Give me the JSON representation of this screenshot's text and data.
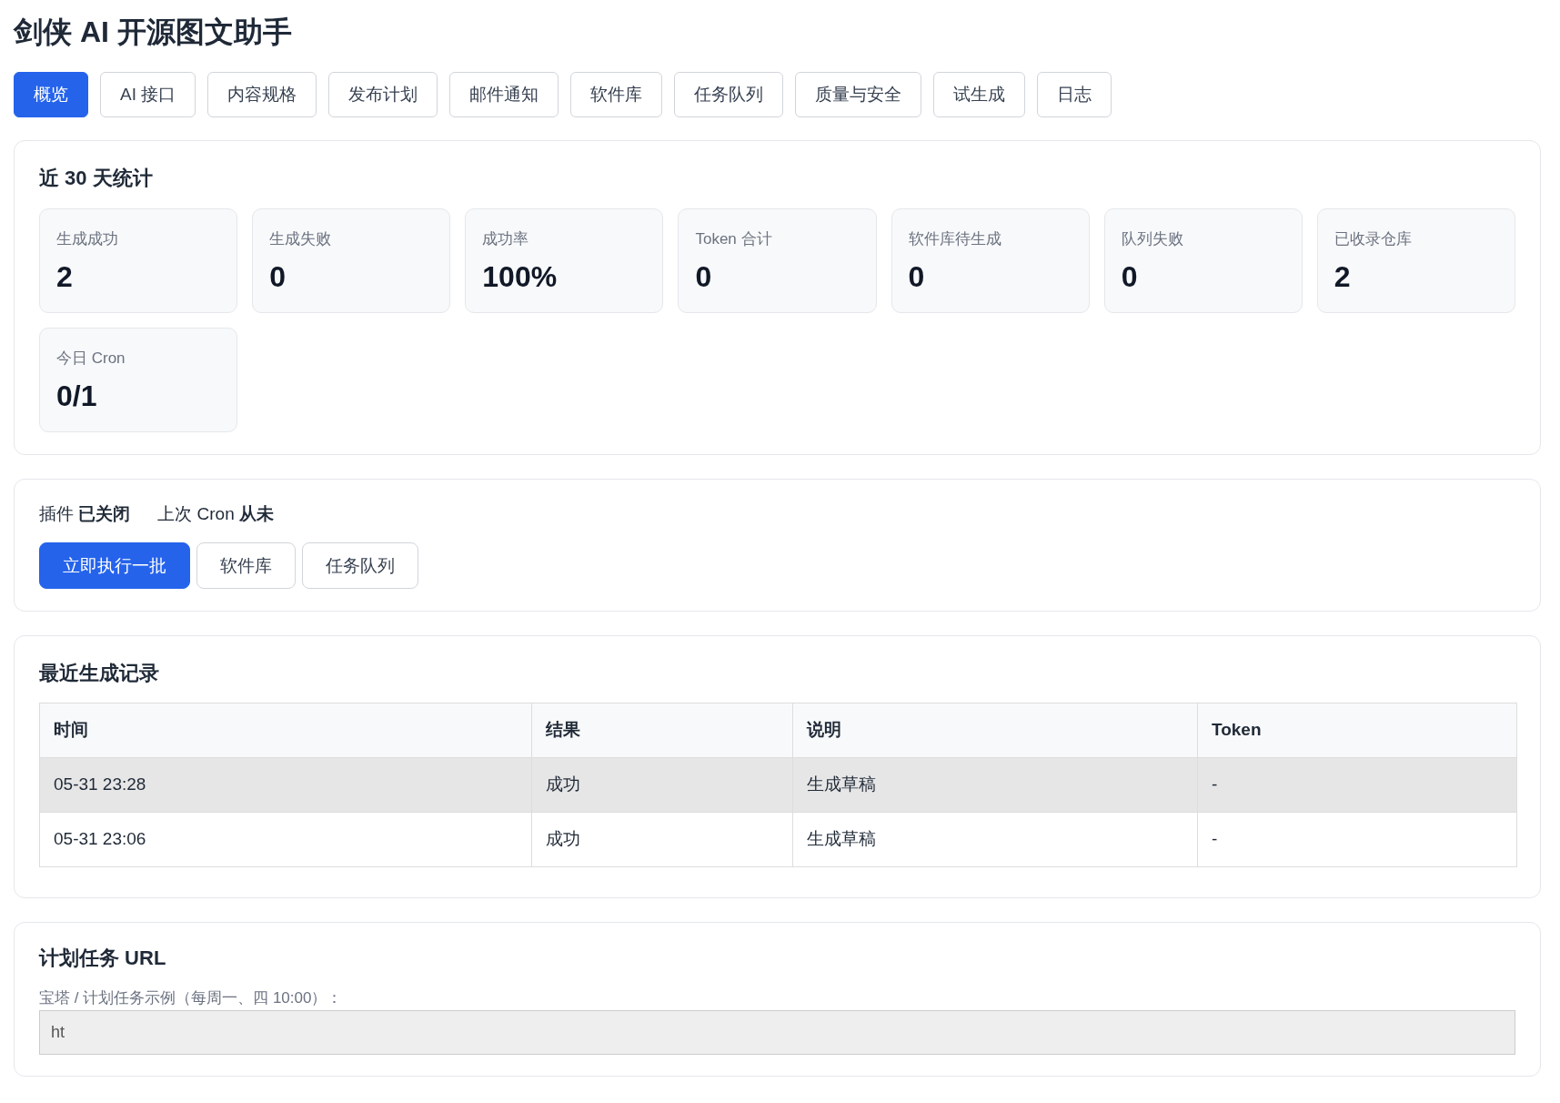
{
  "app_title": "剑侠 AI 开源图文助手",
  "tabs": [
    {
      "label": "概览",
      "selected": true
    },
    {
      "label": "AI 接口",
      "selected": false
    },
    {
      "label": "内容规格",
      "selected": false
    },
    {
      "label": "发布计划",
      "selected": false
    },
    {
      "label": "邮件通知",
      "selected": false
    },
    {
      "label": "软件库",
      "selected": false
    },
    {
      "label": "任务队列",
      "selected": false
    },
    {
      "label": "质量与安全",
      "selected": false
    },
    {
      "label": "试生成",
      "selected": false
    },
    {
      "label": "日志",
      "selected": false
    }
  ],
  "stats_panel": {
    "title": "近 30 天统计",
    "stats": [
      {
        "label": "生成成功",
        "value": "2"
      },
      {
        "label": "生成失败",
        "value": "0"
      },
      {
        "label": "成功率",
        "value": "100%"
      },
      {
        "label": "Token 合计",
        "value": "0"
      },
      {
        "label": "软件库待生成",
        "value": "0"
      },
      {
        "label": "队列失败",
        "value": "0"
      },
      {
        "label": "已收录仓库",
        "value": "2"
      },
      {
        "label": "今日 Cron",
        "value": "0/1"
      }
    ]
  },
  "plugin_panel": {
    "status_texts": [
      "插件 **已关闭**",
      "上次 Cron **从未**"
    ],
    "buttons": [
      {
        "label": "立即执行一批",
        "kind": "primary"
      },
      {
        "label": "软件库",
        "kind": "default"
      },
      {
        "label": "任务队列",
        "kind": "default"
      }
    ]
  },
  "records_panel": {
    "title": "最近生成记录",
    "table": {
      "columns": [
        "时间",
        "结果",
        "说明",
        "Token"
      ],
      "rows": [
        {
          "cells": [
            "05-31 23:28",
            "成功",
            "生成草稿",
            "-"
          ],
          "highlighted": true
        },
        {
          "cells": [
            "05-31 23:06",
            "成功",
            "生成草稿",
            "-"
          ],
          "highlighted": false
        }
      ]
    }
  },
  "cron_url_panel": {
    "title": "计划任务 URL",
    "hint": "宝塔 / 计划任务示例（每周一、四 10:00）：",
    "url_field": {
      "value": "ht"
    }
  }
}
